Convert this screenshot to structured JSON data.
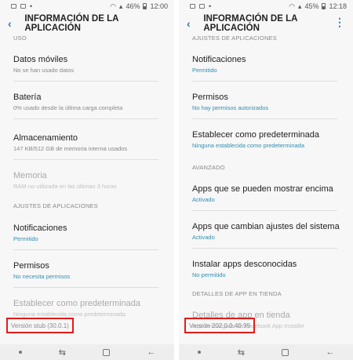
{
  "left": {
    "status_time": "12:00",
    "status_battery": "46%",
    "title": "INFORMACIÓN DE LA APLICACIÓN",
    "section_uso": "USO",
    "items": [
      {
        "title": "Datos móviles",
        "sub": "No se han usado datos"
      },
      {
        "title": "Batería",
        "sub": "0% usado desde la última carga completa"
      },
      {
        "title": "Almacenamiento",
        "sub": "147 KB/512 GB de memoria interna usados"
      },
      {
        "title": "Memoria",
        "sub": "RAM no utilizada en las últimas 3 horas"
      }
    ],
    "section_ajustes": "AJUSTES DE APLICACIONES",
    "items2": [
      {
        "title": "Notificaciones",
        "sub": "Permitido"
      },
      {
        "title": "Permisos",
        "sub": "No necesita permisos"
      },
      {
        "title": "Establecer como predeterminada",
        "sub": "Ninguna establecida como predeterminada"
      }
    ],
    "version": "Versión stub (30.0.1)"
  },
  "right": {
    "status_time": "12:18",
    "status_battery": "45%",
    "title": "INFORMACIÓN DE LA APLICACIÓN",
    "menu_icon": "⋮",
    "section_ajustes": "AJUSTES DE APLICACIONES",
    "items": [
      {
        "title": "Notificaciones",
        "sub": "Permitido"
      },
      {
        "title": "Permisos",
        "sub": "No hay permisos autorizados"
      },
      {
        "title": "Establecer como predeterminada",
        "sub": "Ninguna establecida como predeterminada"
      }
    ],
    "section_avanzado": "AVANZADO",
    "items2": [
      {
        "title": "Apps que se pueden mostrar encima",
        "sub": "Activado"
      },
      {
        "title": "Apps que cambian ajustes del sistema",
        "sub": "Activado"
      },
      {
        "title": "Instalar apps desconocidas",
        "sub": "No permitido"
      }
    ],
    "section_detalles": "DETALLES DE APP EN TIENDA",
    "items3": [
      {
        "title": "Detalles de app en tienda",
        "sub": "App descargada de Facebook App Installer"
      }
    ],
    "version": "Versión 202.0.0.40.99"
  },
  "colors": {
    "accent": "#2d8fb5",
    "highlight": "#e21b1b"
  }
}
